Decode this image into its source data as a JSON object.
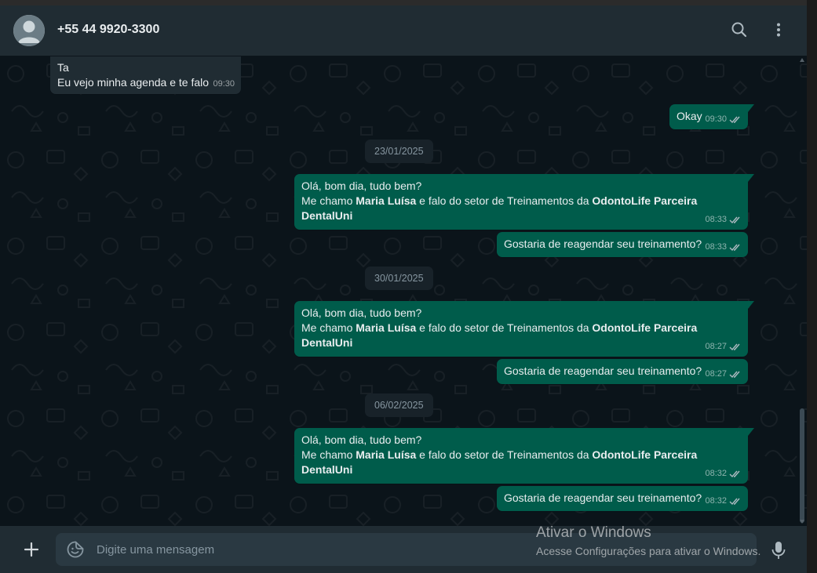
{
  "header": {
    "contact_name": "+55 44 9920-3300",
    "icons": [
      "default-avatar-icon",
      "search-icon",
      "kebab-menu-icon"
    ]
  },
  "messages": [
    {
      "kind": "in",
      "lines": [
        "Ta",
        "Eu vejo minha agenda e te falo"
      ],
      "time": "09:30"
    },
    {
      "kind": "out",
      "text": "Okay",
      "time": "09:30",
      "status": "read"
    },
    {
      "kind": "date",
      "text": "23/01/2025"
    },
    {
      "kind": "out",
      "line1": "Olá, bom dia, tudo bem?",
      "line2_pre": "Me chamo ",
      "line2_bold1": "Maria Luísa",
      "line2_mid": " e falo do setor de Treinamentos da ",
      "line2_bold2": "OdontoLife Parceira",
      "line3_bold": "DentalUni",
      "time": "08:33",
      "status": "read"
    },
    {
      "kind": "out",
      "text": "Gostaria de reagendar seu treinamento?",
      "time": "08:33",
      "status": "read"
    },
    {
      "kind": "date",
      "text": "30/01/2025"
    },
    {
      "kind": "out",
      "line1": "Olá, bom dia, tudo bem?",
      "line2_pre": "Me chamo ",
      "line2_bold1": "Maria Luísa",
      "line2_mid": " e falo do setor de Treinamentos da ",
      "line2_bold2": "OdontoLife Parceira",
      "line3_bold": "DentalUni",
      "time": "08:27",
      "status": "read"
    },
    {
      "kind": "out",
      "text": "Gostaria de reagendar seu treinamento?",
      "time": "08:27",
      "status": "read"
    },
    {
      "kind": "date",
      "text": "06/02/2025"
    },
    {
      "kind": "out",
      "line1": "Olá, bom dia, tudo bem?",
      "line2_pre": "Me chamo ",
      "line2_bold1": "Maria Luísa",
      "line2_mid": " e falo do setor de Treinamentos da ",
      "line2_bold2": "OdontoLife Parceira",
      "line3_bold": "DentalUni",
      "time": "08:32",
      "status": "read"
    },
    {
      "kind": "out",
      "text": "Gostaria de reagendar seu treinamento?",
      "time": "08:32",
      "status": "read"
    }
  ],
  "composer": {
    "placeholder": "Digite uma mensagem",
    "icons": [
      "plus-icon",
      "sticker-icon",
      "mic-icon"
    ]
  },
  "watermark": {
    "title": "Ativar o Windows",
    "subtitle": "Acesse Configurações para ativar o Windows."
  },
  "colors": {
    "chat_background": "#0b141a",
    "header_footer": "#202c33",
    "outgoing_bubble": "#005c4b",
    "incoming_bubble": "#202c33",
    "read_ticks": "#8696a0"
  }
}
